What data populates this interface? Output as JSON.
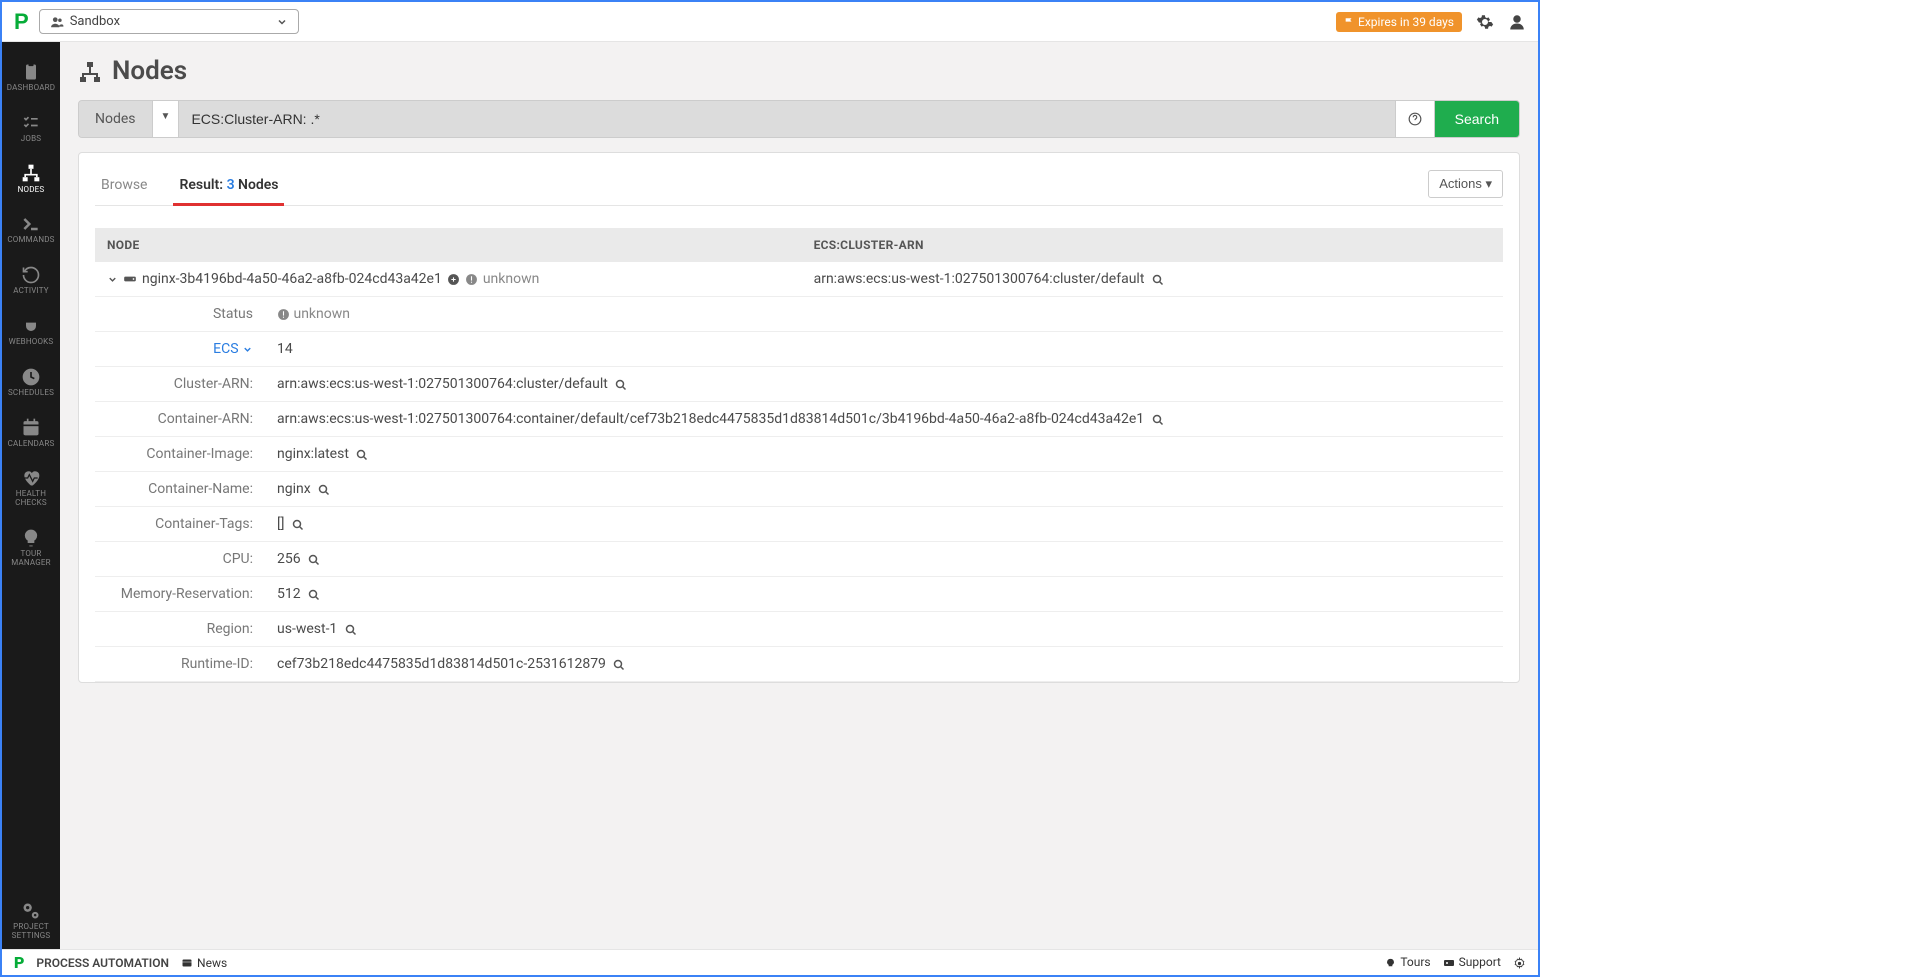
{
  "header": {
    "project": "Sandbox",
    "expires": "Expires in 39 days"
  },
  "sidebar": {
    "items": [
      {
        "label": "DASHBOARD"
      },
      {
        "label": "JOBS"
      },
      {
        "label": "NODES"
      },
      {
        "label": "COMMANDS"
      },
      {
        "label": "ACTIVITY"
      },
      {
        "label": "WEBHOOKS"
      },
      {
        "label": "SCHEDULES"
      },
      {
        "label": "CALENDARS"
      },
      {
        "label": "HEALTH CHECKS"
      },
      {
        "label": "TOUR MANAGER"
      }
    ],
    "bottom": {
      "label": "PROJECT SETTINGS"
    }
  },
  "page": {
    "title": "Nodes",
    "search_label": "Nodes",
    "search_value": "ECS:Cluster-ARN: .*",
    "search_button": "Search"
  },
  "tabs": {
    "browse": "Browse",
    "result_prefix": "Result: ",
    "result_count": "3",
    "result_suffix": " Nodes",
    "actions": "Actions"
  },
  "table": {
    "col_node": "NODE",
    "col_arn": "ECS:CLUSTER-ARN",
    "node_name": "nginx-3b4196bd-4a50-46a2-a8fb-024cd43a42e1",
    "node_status_inline": "unknown",
    "node_arn": "arn:aws:ecs:us-west-1:027501300764:cluster/default"
  },
  "details": {
    "status_label": "Status",
    "status_value": "unknown",
    "ecs_label": "ECS",
    "ecs_value": "14",
    "cluster_arn_label": "Cluster-ARN:",
    "cluster_arn_value": "arn:aws:ecs:us-west-1:027501300764:cluster/default",
    "container_arn_label": "Container-ARN:",
    "container_arn_value": "arn:aws:ecs:us-west-1:027501300764:container/default/cef73b218edc4475835d1d83814d501c/3b4196bd-4a50-46a2-a8fb-024cd43a42e1",
    "container_image_label": "Container-Image:",
    "container_image_value": "nginx:latest",
    "container_name_label": "Container-Name:",
    "container_name_value": "nginx",
    "container_tags_label": "Container-Tags:",
    "container_tags_value": "[]",
    "cpu_label": "CPU:",
    "cpu_value": "256",
    "memory_label": "Memory-Reservation:",
    "memory_value": "512",
    "region_label": "Region:",
    "region_value": "us-west-1",
    "runtime_label": "Runtime-ID:",
    "runtime_value": "cef73b218edc4475835d1d83814d501c-2531612879"
  },
  "footer": {
    "brand": "PROCESS AUTOMATION",
    "news": "News",
    "tours": "Tours",
    "support": "Support"
  }
}
